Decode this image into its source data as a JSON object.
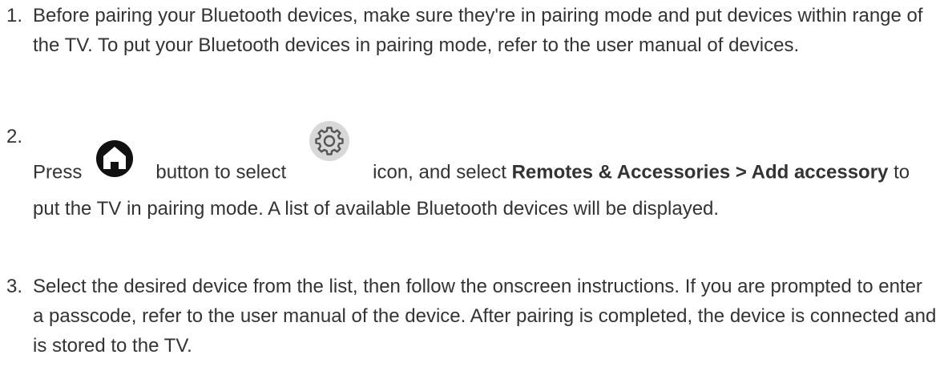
{
  "steps": [
    {
      "number": "1.",
      "text": "Before pairing your Bluetooth devices, make sure they're in pairing mode and put devices within range of the TV. To put your Bluetooth devices in pairing mode, refer to the user manual of devices."
    },
    {
      "number": "2.",
      "press": "Press",
      "home_icon": "home-button-icon",
      "button_to_select": "button to select",
      "gear_icon": "settings-gear-icon",
      "icon_and_select": "icon, and select",
      "menu_path": "Remotes & Accessories > Add accessory",
      "text_after": "to put the TV in pairing mode. A list of available Bluetooth devices will be displayed."
    },
    {
      "number": "3.",
      "text": "Select the desired device from the list, then follow the onscreen instructions. If you are prompted to enter a passcode, refer to the user manual of the device. After pairing is completed, the device is connected and is stored to the TV."
    }
  ],
  "colors": {
    "text": "#333333",
    "home_icon": "#111111",
    "gear_icon_bg": "#d8d8d8",
    "gear_icon_fg": "#555555"
  }
}
